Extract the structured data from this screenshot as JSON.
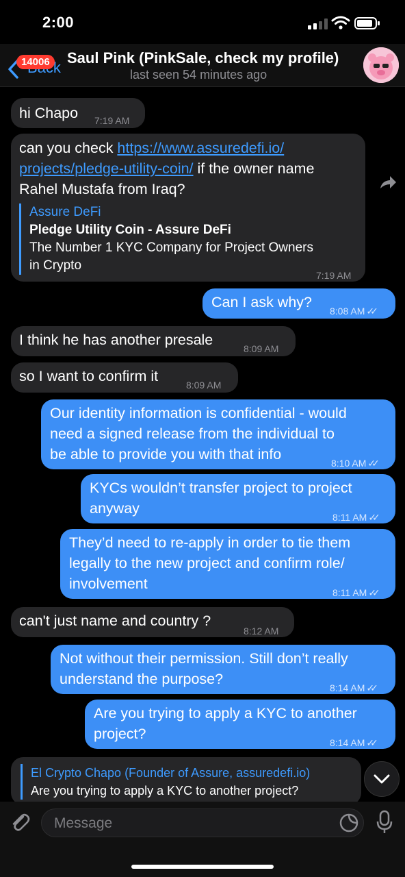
{
  "status_bar": {
    "time": "2:00"
  },
  "header": {
    "back_label": "Back",
    "unread_badge": "14006",
    "title": "Saul Pink (PinkSale, check my profile)",
    "status": "last seen 54 minutes ago"
  },
  "messages": [
    {
      "dir": "in",
      "text": "hi Chapo",
      "time": "7:19 AM"
    },
    {
      "dir": "in",
      "text_before_link": "can you check ",
      "link_line1": "https://www.assuredefi.io/",
      "link_line2": "projects/pledge-utility-coin/",
      "text_after_link": " if the owner name",
      "text_line3": "Rahel Mustafa from Iraq?",
      "preview": {
        "site": "Assure DeFi",
        "title": "Pledge Utility Coin - Assure DeFi",
        "desc_line1": "The Number 1 KYC Company for Project Owners",
        "desc_line2": "in Crypto"
      },
      "time": "7:19 AM"
    },
    {
      "dir": "out",
      "text": "Can I ask why?",
      "time": "8:08 AM"
    },
    {
      "dir": "in",
      "text": "I think he has another presale",
      "time": "8:09 AM"
    },
    {
      "dir": "in",
      "text": "so I want to confirm it",
      "time": "8:09 AM"
    },
    {
      "dir": "out",
      "lines": [
        "Our identity information is confidential - would",
        "need a signed release from the individual to",
        "be able to provide you with that info"
      ],
      "time": "8:10 AM"
    },
    {
      "dir": "out",
      "lines": [
        "KYCs wouldn’t transfer project to project",
        "anyway"
      ],
      "time": "8:11 AM"
    },
    {
      "dir": "out",
      "lines": [
        "They’d need to re-apply in order to tie them",
        "legally to the new project and confirm role/",
        "involvement"
      ],
      "time": "8:11 AM"
    },
    {
      "dir": "in",
      "text": "can't just name and country ?",
      "time": "8:12 AM"
    },
    {
      "dir": "out",
      "lines": [
        "Not without their permission. Still don’t really",
        "understand the purpose?"
      ],
      "time": "8:14 AM"
    },
    {
      "dir": "out",
      "lines": [
        "Are you trying to apply a KYC to another",
        "project?"
      ],
      "time": "8:14 AM"
    }
  ],
  "reply": {
    "author": "El Crypto Chapo (Founder of Assure, assuredefi.io)",
    "quote": "Are you trying to apply a KYC to another project?"
  },
  "input": {
    "placeholder": "Message"
  },
  "colors": {
    "accent": "#3e9bff",
    "outgoing": "#3d8ff6",
    "incoming": "#262628",
    "badge": "#ff3b30"
  },
  "icons": [
    "signal-icon",
    "wifi-icon",
    "battery-icon",
    "back-chevron-icon",
    "share-icon",
    "chevron-down-icon",
    "paperclip-icon",
    "sticker-icon",
    "microphone-icon"
  ]
}
